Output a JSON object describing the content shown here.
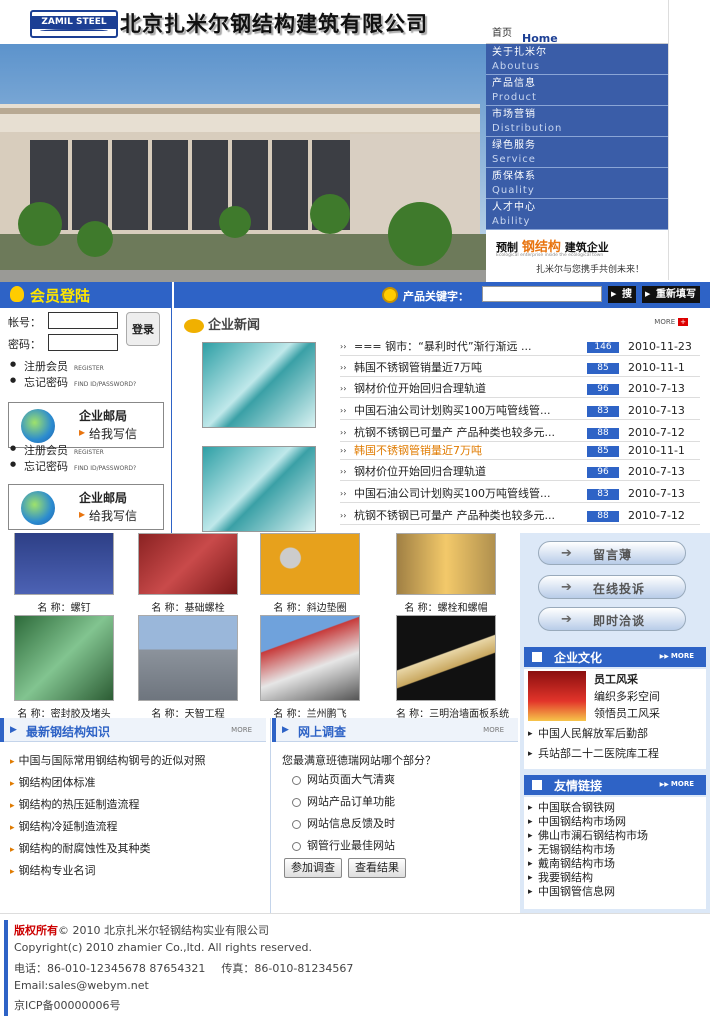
{
  "header": {
    "logo_text": "ZAMIL STEEL",
    "company_name": "北京扎米尔钢结构建筑有限公司"
  },
  "nav": {
    "home_cn": "首页",
    "home_en": "Home",
    "items": [
      {
        "cn": "关于扎米尔",
        "en": "Aboutus"
      },
      {
        "cn": "产品信息",
        "en": "Product"
      },
      {
        "cn": "市场营销",
        "en": "Distribution"
      },
      {
        "cn": "绿色服务",
        "en": "Service"
      },
      {
        "cn": "质保体系",
        "en": "Quality"
      },
      {
        "cn": "人才中心",
        "en": "Ability"
      }
    ]
  },
  "slogan": {
    "prefix": "预制",
    "highlight": "钢结构",
    "suffix": "建筑企业",
    "small": "Ecological enterprise inside the ecological town",
    "tagline": "扎米尔与您携手共创未来！"
  },
  "member": {
    "title": "会员登陆",
    "account_label": "帐号：",
    "password_label": "密码：",
    "login_button": "登录",
    "register": "注册会员",
    "register_en": "REGISTER",
    "forgot": "忘记密码",
    "forgot_en": "FIND ID/PASSWORD?",
    "mail_title": "企业邮局",
    "mail_link": "给我写信"
  },
  "search": {
    "label": "产品关键字：",
    "search_button": "搜",
    "reset_button": "重新填写"
  },
  "news": {
    "title": "企业新闻",
    "more": "MORE",
    "items": [
      {
        "title": "=== 钢市：“暴利时代”渐行渐远 ...",
        "count": "146",
        "date": "2010-11-23",
        "hl": false
      },
      {
        "title": "韩国不锈钢管销量近7万吨",
        "count": "85",
        "date": "2010-11-1",
        "hl": false
      },
      {
        "title": "钢材价位开始回归合理轨道",
        "count": "96",
        "date": "2010-7-13",
        "hl": false
      },
      {
        "title": "中国石油公司计划购买100万吨管线管...",
        "count": "83",
        "date": "2010-7-13",
        "hl": false
      },
      {
        "title": "杭钢不锈钢已可量产 产品种类也较多元...",
        "count": "88",
        "date": "2010-7-12",
        "hl": false
      },
      {
        "title": "韩国不锈钢管销量近7万吨",
        "count": "85",
        "date": "2010-11-1",
        "hl": true
      },
      {
        "title": "钢材价位开始回归合理轨道",
        "count": "96",
        "date": "2010-7-13",
        "hl": false
      },
      {
        "title": "中国石油公司计划购买100万吨管线管...",
        "count": "83",
        "date": "2010-7-13",
        "hl": false
      },
      {
        "title": "杭钢不锈钢已可量产 产品种类也较多元...",
        "count": "88",
        "date": "2010-7-12",
        "hl": false
      }
    ]
  },
  "products": [
    {
      "caption": "名 称：螺钉"
    },
    {
      "caption": "名 称：基础螺栓"
    },
    {
      "caption": "名 称：斜边垫圈"
    },
    {
      "caption": "名 称：螺栓和螺帽"
    },
    {
      "caption": "名 称：密封胶及堵头"
    },
    {
      "caption": "名 称：天智工程"
    },
    {
      "caption": "名 称：兰州鹏飞"
    },
    {
      "caption": "名 称：三明治墙面板系统"
    }
  ],
  "right": {
    "buttons": [
      "留言薄",
      "在线投诉",
      "即时洽谈"
    ],
    "culture_title": "企业文化",
    "more": "MORE",
    "culture_items": [
      "员工风采",
      "编织多彩空间",
      "领悟员工风采"
    ],
    "culture_links": [
      "中国人民解放军后勤部",
      "兵站部二十二医院库工程"
    ],
    "links_title": "友情链接",
    "links": [
      "中国联合钢铁网",
      "中国钢结构市场网",
      "佛山市澜石钢结构市场",
      "无锡钢结构市场",
      "戴南钢结构市场",
      "我要钢结构",
      "中国钢管信息网"
    ]
  },
  "knowledge": {
    "title": "最新钢结构知识",
    "more": "MORE",
    "items": [
      "中国与国际常用钢结构钢号的近似对照",
      "钢结构团体标准",
      "钢结构的热压延制造流程",
      "钢结构冷延制造流程",
      "钢结构的耐腐蚀性及其种类",
      "钢结构专业名词"
    ]
  },
  "survey": {
    "title": "网上调查",
    "more": "MORE",
    "question": "您最满意班德瑞网站哪个部分？",
    "options": [
      "网站页面大气清爽",
      "网站产品订单功能",
      "网站信息反馈及时",
      "钢管行业最佳网站"
    ],
    "vote_button": "参加调查",
    "result_button": "查看结果"
  },
  "footer": {
    "copyright_label": "版权所有",
    "copyright_cn": "© 2010 北京扎米尔轻钢结构实业有限公司",
    "copyright_en": "Copyright(c) 2010 zhamier Co.,ltd. All rights reserved.",
    "phone": "电话：86-010-12345678 87654321",
    "fax": "传真：86-010-81234567",
    "email": "Email:sales@webym.net",
    "icp": "京ICP备00000006号"
  }
}
